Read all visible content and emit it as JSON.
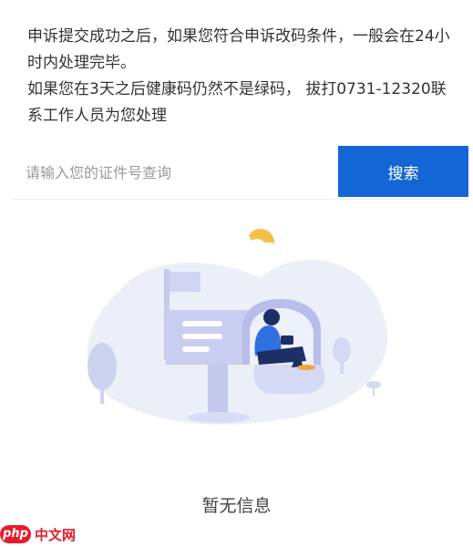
{
  "notice": {
    "line1": "申诉提交成功之后，如果您符合申诉改码条件，一般会在24小时内处理完毕。",
    "line2": "如果您在3天之后健康码仍然不是绿码， 拔打0731-12320联系工作人员为您处理"
  },
  "search": {
    "placeholder": "请输入您的证件号查询",
    "value": "",
    "button_label": "搜索"
  },
  "empty_state": {
    "text": "暂无信息",
    "illustration": "mailbox-person-illustration"
  },
  "watermark": {
    "logo": "php",
    "text": "中文网"
  },
  "colors": {
    "accent": "#1466d6",
    "text": "#333333",
    "placeholder": "#9a9a9a",
    "illustration_blob": "#eceef8",
    "illustration_mailbox": "#c9cdef",
    "sun": "#f5c04a",
    "watermark": "#e61c2c"
  }
}
